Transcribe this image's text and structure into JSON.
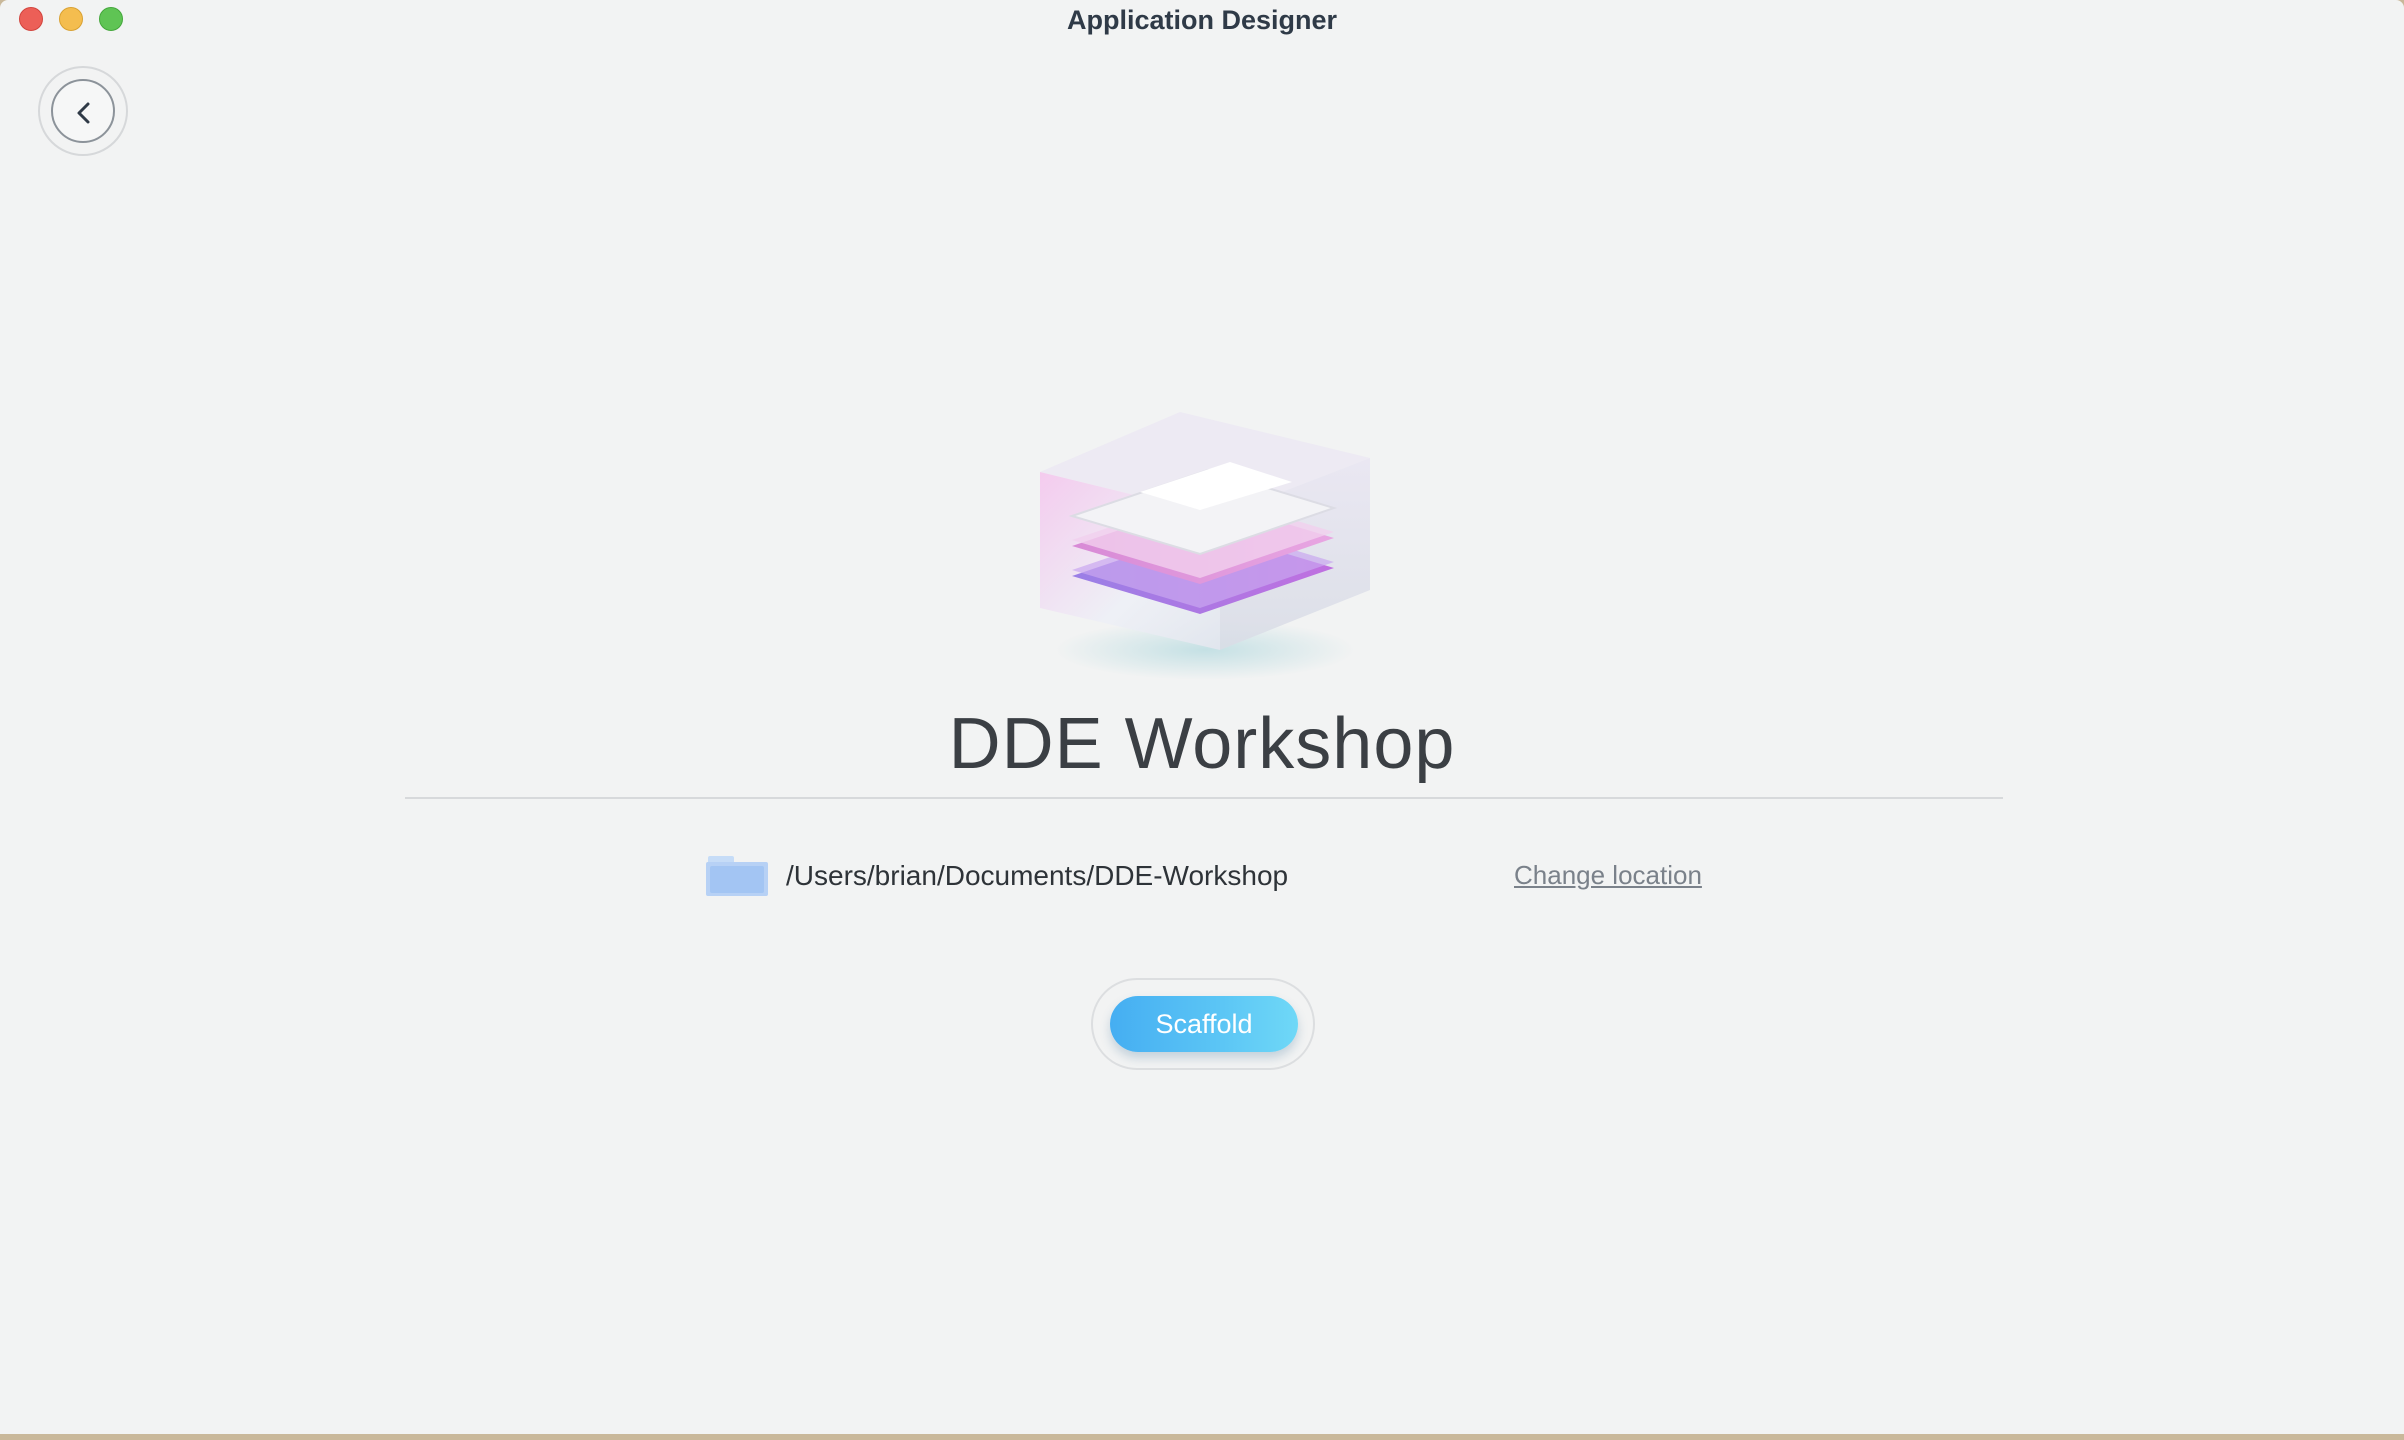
{
  "window": {
    "title": "Application Designer"
  },
  "navigation": {
    "back_icon": "chevron-left-icon"
  },
  "project": {
    "name": "DDE Workshop",
    "location_icon": "folder-icon",
    "path": "/Users/brian/Documents/DDE-Workshop",
    "change_location_label": "Change location"
  },
  "actions": {
    "scaffold_label": "Scaffold"
  },
  "colors": {
    "accent": "#4fb9f4",
    "window_bg": "#f2f3f3",
    "title_text": "#2f3a47",
    "close": "#ec5f57",
    "minimize": "#f4bd4f",
    "zoom": "#5fc454"
  }
}
